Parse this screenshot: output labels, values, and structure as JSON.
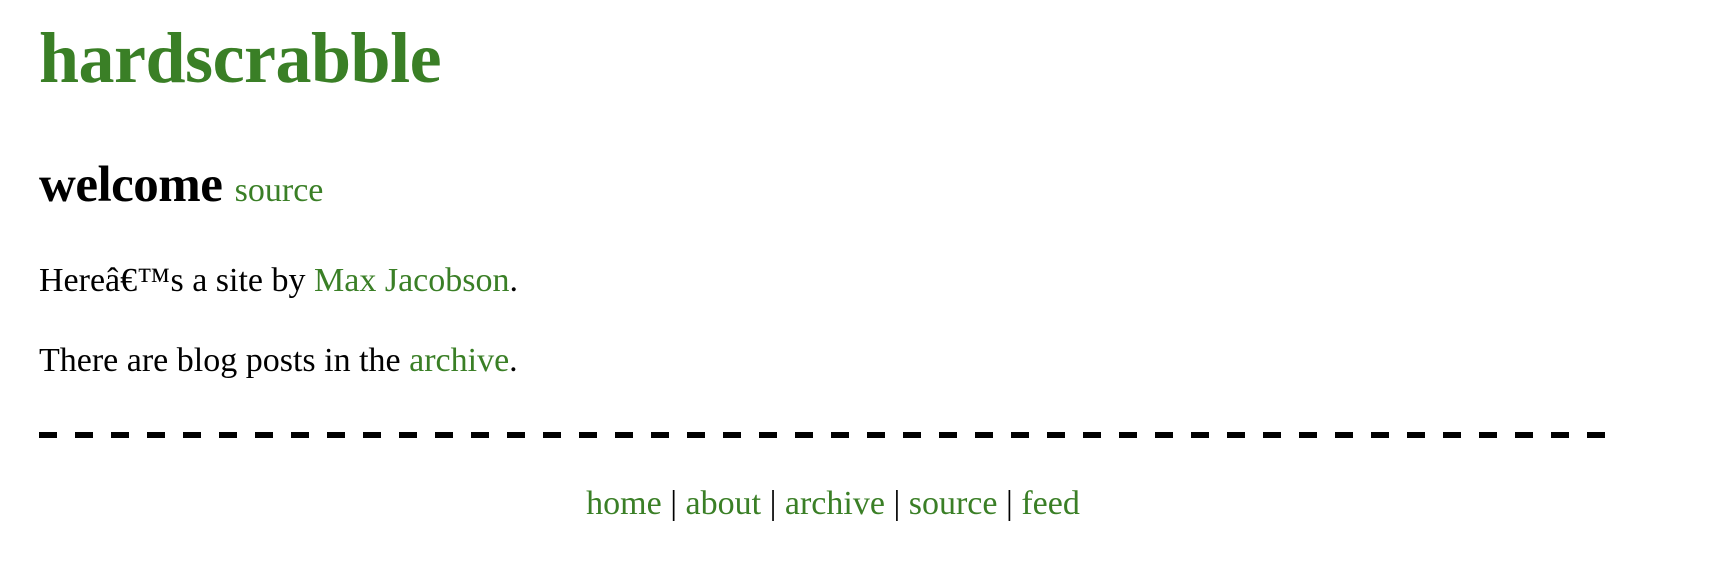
{
  "site": {
    "title": "hardscrabble",
    "accent_color": "#3a7f26"
  },
  "post": {
    "heading": "welcome",
    "source_link": "source"
  },
  "paragraphs": [
    {
      "before": "Hereâ€™s a site by ",
      "link": "Max Jacobson",
      "after": "."
    },
    {
      "before": "There are blog posts in the ",
      "link": "archive",
      "after": "."
    }
  ],
  "footer": {
    "separator": "|",
    "links": [
      "home",
      "about",
      "archive",
      "source",
      "feed"
    ]
  }
}
